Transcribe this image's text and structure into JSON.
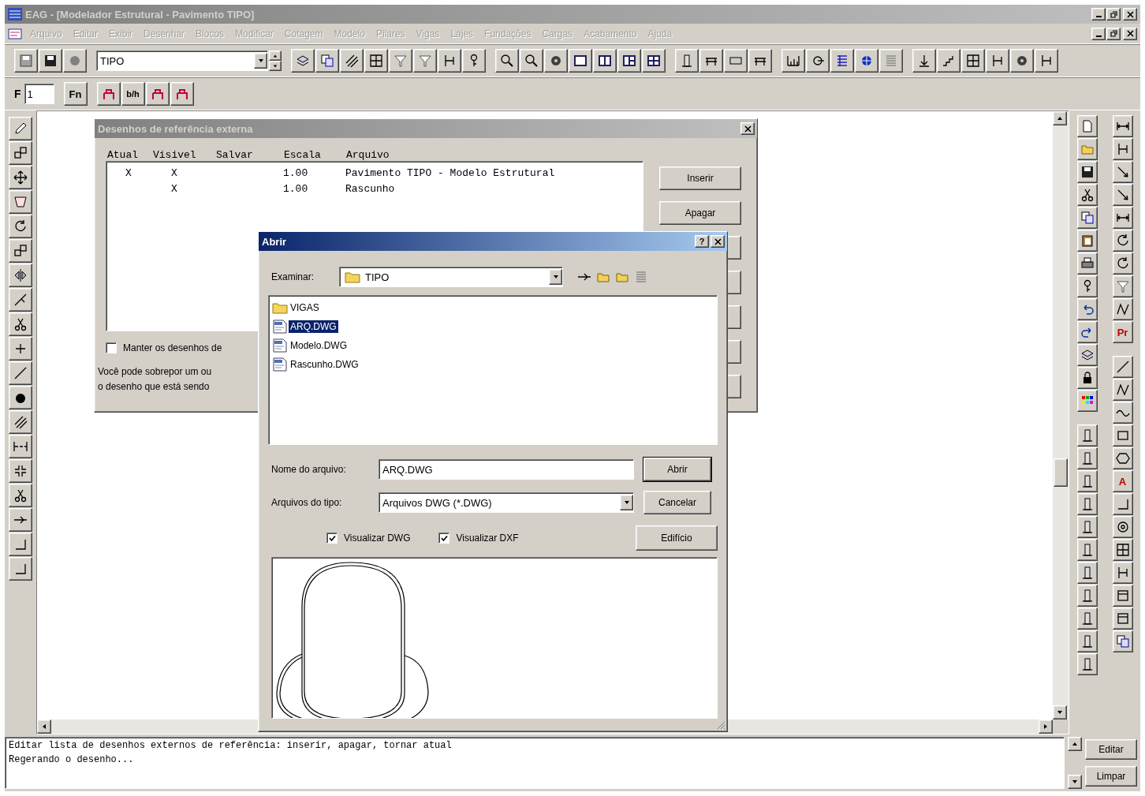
{
  "window": {
    "title": "EAG - [Modelador Estrutural - Pavimento TIPO]"
  },
  "menu": [
    {
      "label": "Arquivo",
      "disabled": true
    },
    {
      "label": "Editar",
      "disabled": true
    },
    {
      "label": "Exibir",
      "disabled": true
    },
    {
      "label": "Desenhar",
      "disabled": true
    },
    {
      "label": "Blocos",
      "disabled": true
    },
    {
      "label": "Modificar",
      "disabled": true
    },
    {
      "label": "Cotagem",
      "disabled": true
    },
    {
      "label": "Modelo",
      "disabled": true
    },
    {
      "label": "Pilares",
      "disabled": true
    },
    {
      "label": "Vigas",
      "disabled": true
    },
    {
      "label": "Lajes",
      "disabled": true
    },
    {
      "label": "Fundações",
      "disabled": true
    },
    {
      "label": "Cargas",
      "disabled": true
    },
    {
      "label": "Acabamento",
      "disabled": true
    },
    {
      "label": "Ajuda",
      "disabled": true
    }
  ],
  "toolbar": {
    "pavement": "TIPO"
  },
  "floor_bar": {
    "label": "F",
    "value": "1",
    "fn_button": "Fn",
    "bh_button": "b/h"
  },
  "drawing_tools": {
    "text_buttons": [
      "Pr",
      "A"
    ]
  },
  "reference_dialog": {
    "title": "Desenhos de referência externa",
    "columns": [
      "Atual",
      "Visivel",
      "Salvar",
      "Escala",
      "Arquivo"
    ],
    "rows": [
      {
        "atual": "X",
        "visivel": "X",
        "escala": "1.00",
        "arquivo": "Pavimento TIPO - Modelo Estrutural"
      },
      {
        "visivel": "X",
        "escala": "1.00",
        "arquivo": "Rascunho"
      }
    ],
    "buttons": [
      "Inserir",
      "Apagar"
    ],
    "keep_checkbox": {
      "label": "Manter os desenhos de",
      "checked": false
    },
    "info": [
      "Você pode sobrepor um ou",
      "o desenho que está sendo"
    ]
  },
  "open_dialog": {
    "title": "Abrir",
    "help_button": "?",
    "look_in_label": "Examinar:",
    "look_in": "TIPO",
    "files": [
      {
        "name": "VIGAS",
        "kind": "folder",
        "selected": false
      },
      {
        "name": "ARQ.DWG",
        "kind": "drawing",
        "selected": true
      },
      {
        "name": "Modelo.DWG",
        "kind": "drawing",
        "selected": false
      },
      {
        "name": "Rascunho.DWG",
        "kind": "drawing",
        "selected": false
      }
    ],
    "file_name_label": "Nome do arquivo:",
    "file_name": "ARQ.DWG",
    "file_type_label": "Arquivos do tipo:",
    "file_type": "Arquivos DWG (*.DWG)",
    "buttons": [
      "Abrir",
      "Cancelar",
      "Edifício"
    ],
    "options": [
      {
        "label": "Visualizar DWG",
        "checked": true
      },
      {
        "label": "Visualizar DXF",
        "checked": true
      }
    ]
  },
  "command_log": {
    "lines": [
      "Editar lista de desenhos externos de referência: inserir, apagar, tornar atual",
      "Regerando o desenho..."
    ],
    "buttons": [
      "Editar",
      "Limpar"
    ]
  }
}
